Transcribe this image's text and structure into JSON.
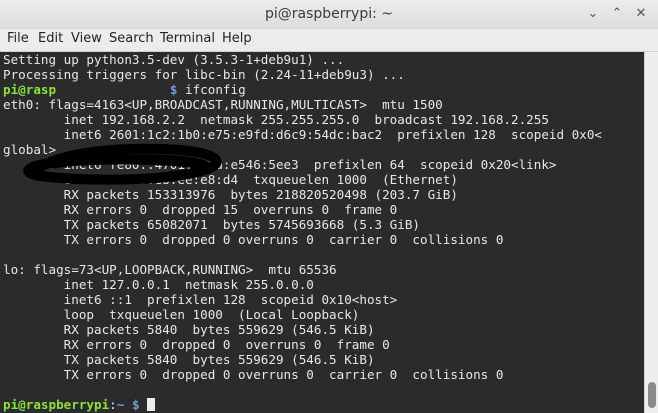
{
  "window": {
    "title": "pi@raspberrypi: ~",
    "controls": [
      "⌄",
      "⌃",
      "✕"
    ]
  },
  "menu": [
    "File",
    "Edit",
    "View",
    "Search",
    "Terminal",
    "Help"
  ],
  "terminal": {
    "lines": [
      "Setting up python3.5-dev (3.5.3-1+deb9u1) ...",
      "Processing triggers for libc-bin (2.24-11+deb9u3) ...",
      "",
      "eth0: flags=4163<UP,BROADCAST,RUNNING,MULTICAST>  mtu 1500",
      "        inet 192.168.2.2  netmask 255.255.255.0  broadcast 192.168.2.255",
      "        inet6 2601:1c2:1b0:e75:e9fd:d6c9:54dc:bac2  prefixlen 128  scopeid 0x0<",
      "global>",
      "        inet6 fe80::4701:ca1a:e546:5ee3  prefixlen 64  scopeid 0x20<link>",
      "        ether b8:27:eb:ee:e8:d4  txqueuelen 1000  (Ethernet)",
      "        RX packets 153313976  bytes 218820520498 (203.7 GiB)",
      "        RX errors 0  dropped 15  overruns 0  frame 0",
      "        TX packets 65082071  bytes 5745693668 (5.3 GiB)",
      "        TX errors 0  dropped 0 overruns 0  carrier 0  collisions 0",
      "",
      "lo: flags=73<UP,LOOPBACK,RUNNING>  mtu 65536",
      "        inet 127.0.0.1  netmask 255.0.0.0",
      "        inet6 ::1  prefixlen 128  scopeid 0x10<host>",
      "        loop  txqueuelen 1000  (Local Loopback)",
      "        RX packets 5840  bytes 559629 (546.5 KiB)",
      "        RX errors 0  dropped 0  overruns 0  frame 0",
      "        TX packets 5840  bytes 559629 (546.5 KiB)",
      "        TX errors 0  dropped 0 overruns 0  carrier 0  collisions 0",
      ""
    ],
    "cmd_prompt": {
      "user": "pi@rasp",
      "path": "~",
      "symbol": "$",
      "command": "ifconfig"
    },
    "last_prompt": {
      "user": "pi@raspberrypi",
      "sep": ":",
      "path": "~",
      "symbol": "$"
    }
  }
}
